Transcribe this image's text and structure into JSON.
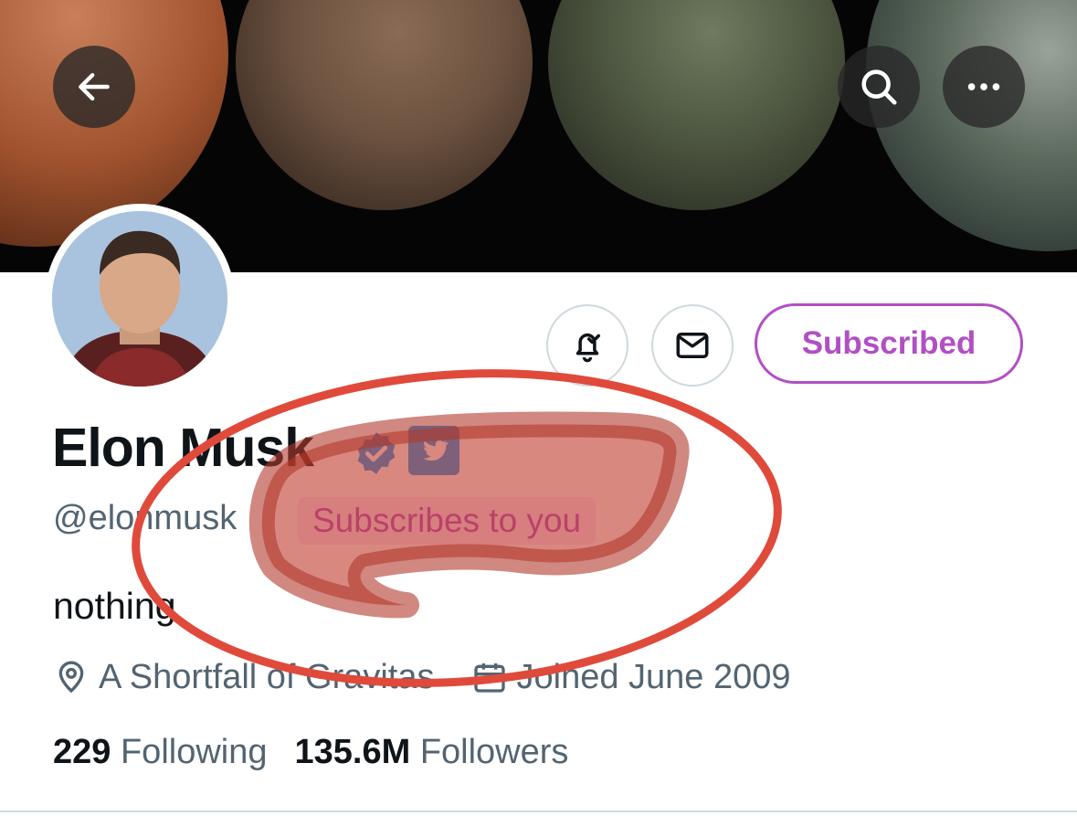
{
  "banner": {
    "back_icon": "arrow-left-icon",
    "search_icon": "search-icon",
    "more_icon": "more-horizontal-icon"
  },
  "profile": {
    "name": "Elon Musk",
    "handle": "@elonmusk",
    "subscribes_badge": "Subscribes to you",
    "bio": "nothing",
    "location": "A Shortfall of Gravitas",
    "joined": "Joined June 2009",
    "following_count": "229",
    "following_label": "Following",
    "followers_count": "135.6M",
    "followers_label": "Followers"
  },
  "actions": {
    "notification_icon": "bell-check-icon",
    "message_icon": "envelope-icon",
    "subscribed_label": "Subscribed"
  },
  "colors": {
    "accent_purple": "#b14fc5",
    "verified_blue": "#1d9bf0",
    "muted_text": "#536471",
    "annotation_red": "#e04a3b"
  }
}
